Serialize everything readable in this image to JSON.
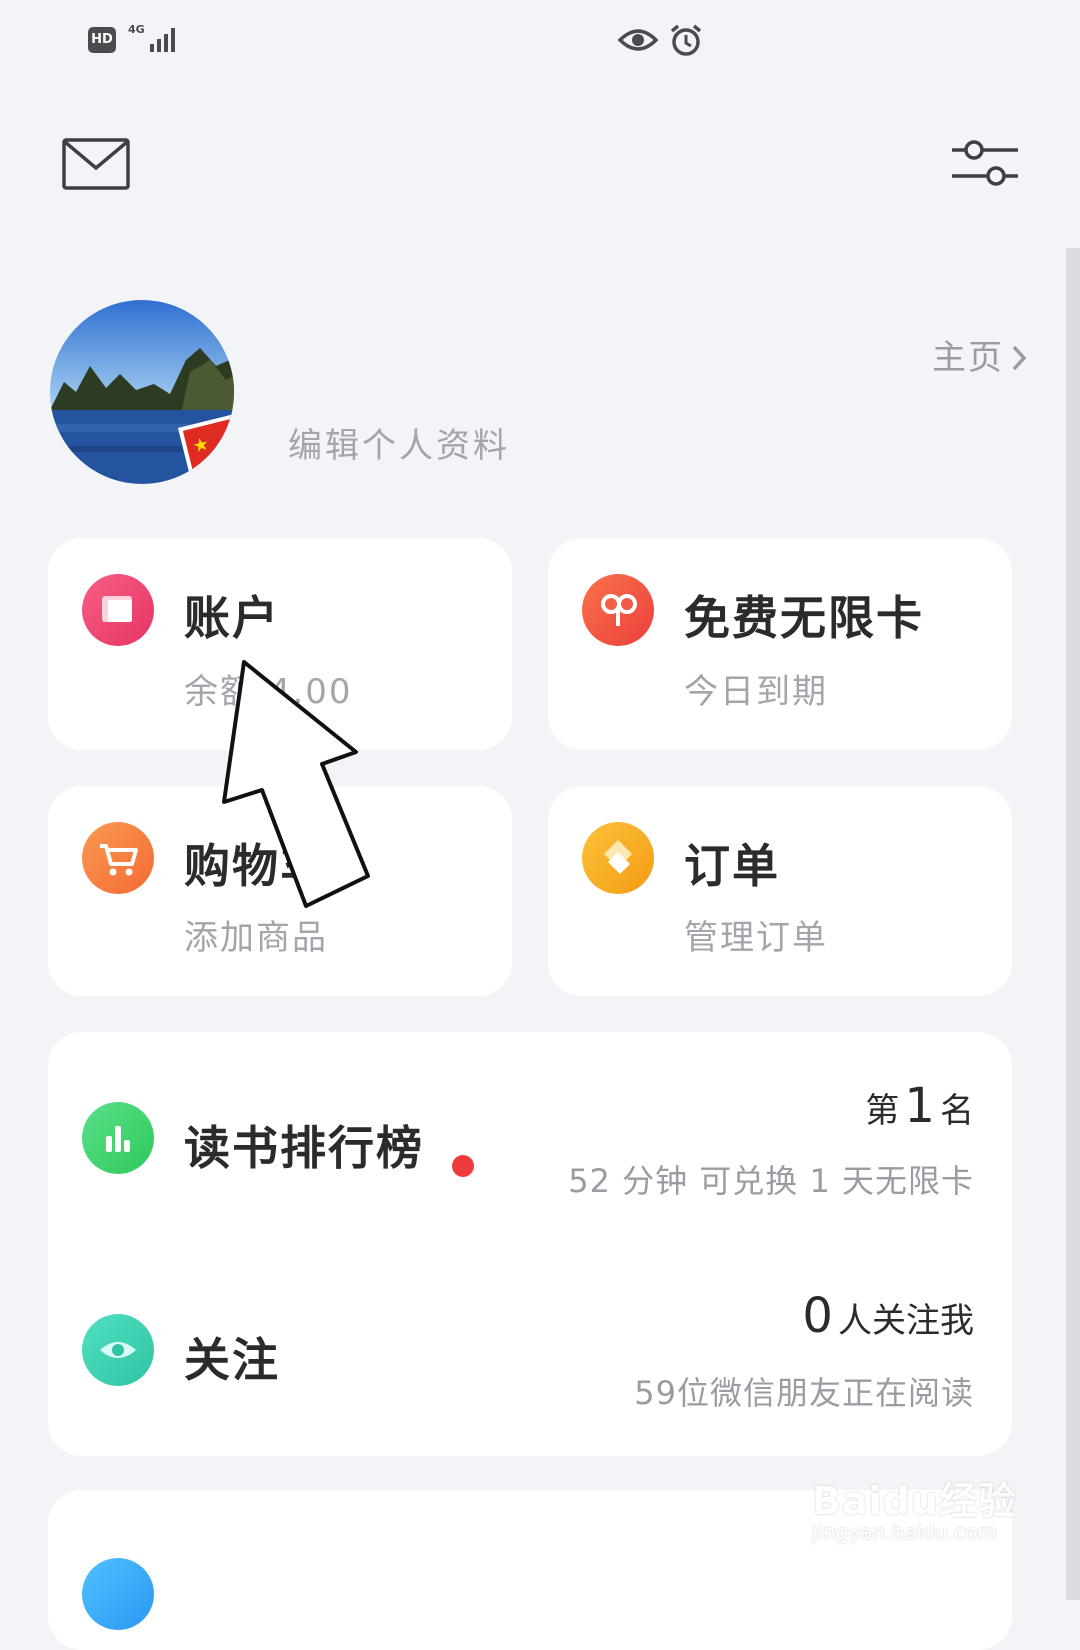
{
  "status_bar": {
    "hd": "HD",
    "network": "4G"
  },
  "header": {
    "mail_icon": "mail-icon",
    "settings_icon": "filter-sliders-icon"
  },
  "profile": {
    "home_link": "主页",
    "edit_label": "编辑个人资料"
  },
  "tiles": [
    {
      "title": "账户",
      "subtitle": "余额 4.00",
      "icon": "wallet-icon",
      "color": "#ef4a72"
    },
    {
      "title": "免费无限卡",
      "subtitle": "今日到期",
      "icon": "infinity-card-icon",
      "color": "#f25a44"
    },
    {
      "title": "购物车",
      "subtitle": "添加商品",
      "icon": "cart-icon",
      "color": "#f7833d"
    },
    {
      "title": "订单",
      "subtitle": "管理订单",
      "icon": "order-icon",
      "color": "#f8aa22"
    }
  ],
  "ranking": {
    "title": "读书排行榜",
    "rank_prefix": "第",
    "rank_value": "1",
    "rank_suffix": "名",
    "detail": "52 分钟 可兑换 1 天无限卡",
    "icon": "bar-chart-icon",
    "color": "#3fd56e"
  },
  "follow": {
    "title": "关注",
    "count": "0",
    "count_label": "人关注我",
    "detail": "59位微信朋友正在阅读",
    "icon": "eye-icon",
    "color": "#3ad3b3"
  },
  "watermark": {
    "brand": "Baidu经验",
    "url": "jingyan.baidu.com"
  }
}
